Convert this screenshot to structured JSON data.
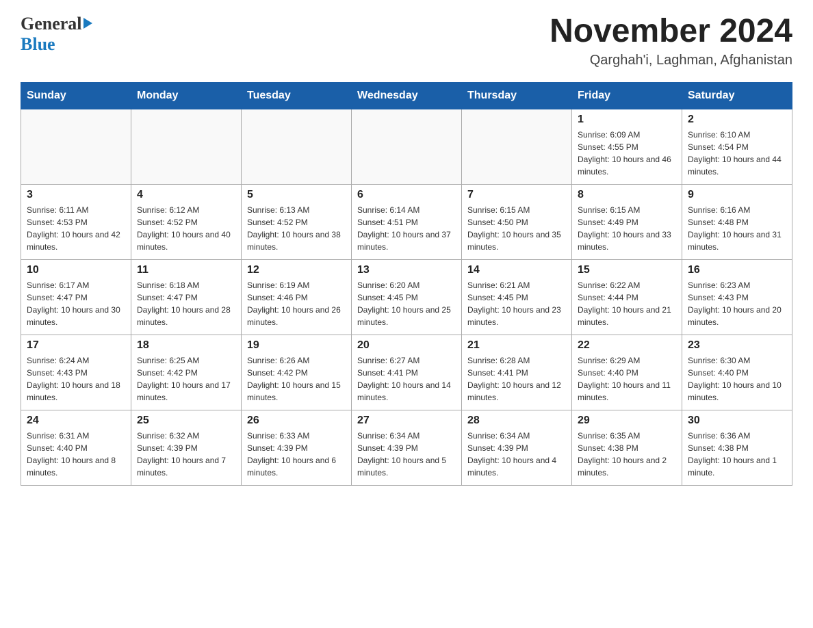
{
  "header": {
    "logo_general": "General",
    "logo_blue": "Blue",
    "month_title": "November 2024",
    "location": "Qarghah'i, Laghman, Afghanistan"
  },
  "days_of_week": [
    "Sunday",
    "Monday",
    "Tuesday",
    "Wednesday",
    "Thursday",
    "Friday",
    "Saturday"
  ],
  "weeks": [
    [
      {
        "day": "",
        "info": ""
      },
      {
        "day": "",
        "info": ""
      },
      {
        "day": "",
        "info": ""
      },
      {
        "day": "",
        "info": ""
      },
      {
        "day": "",
        "info": ""
      },
      {
        "day": "1",
        "info": "Sunrise: 6:09 AM\nSunset: 4:55 PM\nDaylight: 10 hours and 46 minutes."
      },
      {
        "day": "2",
        "info": "Sunrise: 6:10 AM\nSunset: 4:54 PM\nDaylight: 10 hours and 44 minutes."
      }
    ],
    [
      {
        "day": "3",
        "info": "Sunrise: 6:11 AM\nSunset: 4:53 PM\nDaylight: 10 hours and 42 minutes."
      },
      {
        "day": "4",
        "info": "Sunrise: 6:12 AM\nSunset: 4:52 PM\nDaylight: 10 hours and 40 minutes."
      },
      {
        "day": "5",
        "info": "Sunrise: 6:13 AM\nSunset: 4:52 PM\nDaylight: 10 hours and 38 minutes."
      },
      {
        "day": "6",
        "info": "Sunrise: 6:14 AM\nSunset: 4:51 PM\nDaylight: 10 hours and 37 minutes."
      },
      {
        "day": "7",
        "info": "Sunrise: 6:15 AM\nSunset: 4:50 PM\nDaylight: 10 hours and 35 minutes."
      },
      {
        "day": "8",
        "info": "Sunrise: 6:15 AM\nSunset: 4:49 PM\nDaylight: 10 hours and 33 minutes."
      },
      {
        "day": "9",
        "info": "Sunrise: 6:16 AM\nSunset: 4:48 PM\nDaylight: 10 hours and 31 minutes."
      }
    ],
    [
      {
        "day": "10",
        "info": "Sunrise: 6:17 AM\nSunset: 4:47 PM\nDaylight: 10 hours and 30 minutes."
      },
      {
        "day": "11",
        "info": "Sunrise: 6:18 AM\nSunset: 4:47 PM\nDaylight: 10 hours and 28 minutes."
      },
      {
        "day": "12",
        "info": "Sunrise: 6:19 AM\nSunset: 4:46 PM\nDaylight: 10 hours and 26 minutes."
      },
      {
        "day": "13",
        "info": "Sunrise: 6:20 AM\nSunset: 4:45 PM\nDaylight: 10 hours and 25 minutes."
      },
      {
        "day": "14",
        "info": "Sunrise: 6:21 AM\nSunset: 4:45 PM\nDaylight: 10 hours and 23 minutes."
      },
      {
        "day": "15",
        "info": "Sunrise: 6:22 AM\nSunset: 4:44 PM\nDaylight: 10 hours and 21 minutes."
      },
      {
        "day": "16",
        "info": "Sunrise: 6:23 AM\nSunset: 4:43 PM\nDaylight: 10 hours and 20 minutes."
      }
    ],
    [
      {
        "day": "17",
        "info": "Sunrise: 6:24 AM\nSunset: 4:43 PM\nDaylight: 10 hours and 18 minutes."
      },
      {
        "day": "18",
        "info": "Sunrise: 6:25 AM\nSunset: 4:42 PM\nDaylight: 10 hours and 17 minutes."
      },
      {
        "day": "19",
        "info": "Sunrise: 6:26 AM\nSunset: 4:42 PM\nDaylight: 10 hours and 15 minutes."
      },
      {
        "day": "20",
        "info": "Sunrise: 6:27 AM\nSunset: 4:41 PM\nDaylight: 10 hours and 14 minutes."
      },
      {
        "day": "21",
        "info": "Sunrise: 6:28 AM\nSunset: 4:41 PM\nDaylight: 10 hours and 12 minutes."
      },
      {
        "day": "22",
        "info": "Sunrise: 6:29 AM\nSunset: 4:40 PM\nDaylight: 10 hours and 11 minutes."
      },
      {
        "day": "23",
        "info": "Sunrise: 6:30 AM\nSunset: 4:40 PM\nDaylight: 10 hours and 10 minutes."
      }
    ],
    [
      {
        "day": "24",
        "info": "Sunrise: 6:31 AM\nSunset: 4:40 PM\nDaylight: 10 hours and 8 minutes."
      },
      {
        "day": "25",
        "info": "Sunrise: 6:32 AM\nSunset: 4:39 PM\nDaylight: 10 hours and 7 minutes."
      },
      {
        "day": "26",
        "info": "Sunrise: 6:33 AM\nSunset: 4:39 PM\nDaylight: 10 hours and 6 minutes."
      },
      {
        "day": "27",
        "info": "Sunrise: 6:34 AM\nSunset: 4:39 PM\nDaylight: 10 hours and 5 minutes."
      },
      {
        "day": "28",
        "info": "Sunrise: 6:34 AM\nSunset: 4:39 PM\nDaylight: 10 hours and 4 minutes."
      },
      {
        "day": "29",
        "info": "Sunrise: 6:35 AM\nSunset: 4:38 PM\nDaylight: 10 hours and 2 minutes."
      },
      {
        "day": "30",
        "info": "Sunrise: 6:36 AM\nSunset: 4:38 PM\nDaylight: 10 hours and 1 minute."
      }
    ]
  ]
}
